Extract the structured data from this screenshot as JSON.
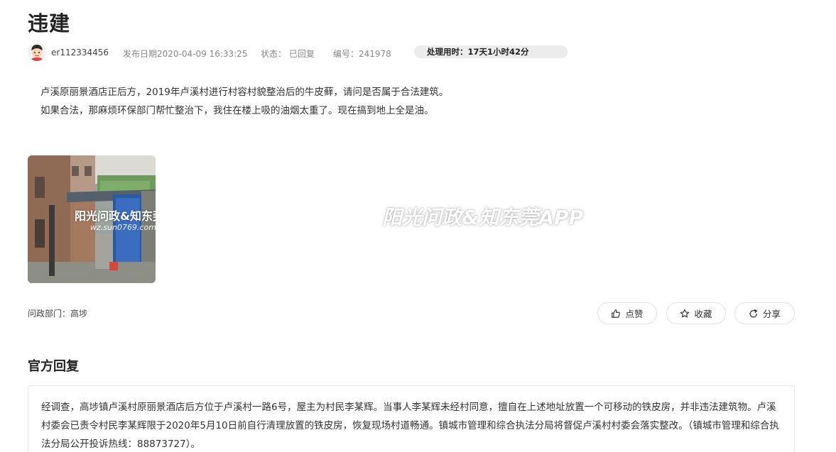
{
  "post": {
    "title": "违建",
    "author": "er112334456",
    "date_text": "发布日期2020-04-09 16:33:25",
    "status_text": "状态： 已回复",
    "id_text": "编号：241978",
    "process_time": "处理用时：17天1小时42分",
    "content": [
      "卢溪原丽景酒店正后方，2019年卢溪村进行村容村貌整治后的牛皮藓，请问是否属于合法建筑。",
      "如果合法，那麻烦环保部门帮忙整治下，我住在楼上吸的油烟太重了。现在搞到地上全是油。"
    ],
    "photo_watermark": "阳光问政&知东莞",
    "photo_watermark_url": "wz.sun0769.com",
    "image_watermark": "阳光问政&知东莞APP",
    "department": "问政部门：高埗"
  },
  "actions": {
    "like": "点赞",
    "favorite": "收藏",
    "share": "分享"
  },
  "reply": {
    "heading": "官方回复",
    "text": "经调查，高埗镇卢溪村原丽景酒店后方位于卢溪村一路6号，屋主为村民李某辉。当事人李某辉未经村同意，擅自在上述地址放置一个可移动的铁皮房，并非违法建筑物。卢溪村委会已责令村民李某辉限于2020年5月10日前自行清理放置的铁皮房，恢复现场村道畅通。镇城市管理和综合执法分局将督促卢溪村村委会落实整改。（镇城市管理和综合执法分局公开投诉热线：88873727）。"
  },
  "icons": {
    "avatar": "avatar-cartoon-icon",
    "like": "thumbs-up-icon",
    "favorite": "star-icon",
    "share": "share-icon"
  },
  "colors": {
    "pill_bg": "#ececec",
    "border": "#e2e2e2",
    "title": "#222222"
  }
}
